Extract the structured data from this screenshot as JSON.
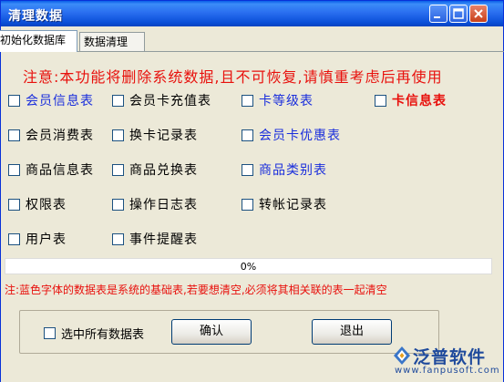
{
  "window": {
    "title": "清理数据"
  },
  "tabs": [
    {
      "label": "初始化数据库",
      "active": true
    },
    {
      "label": "数据清理",
      "active": false
    }
  ],
  "warning": "注意:本功能将删除系统数据,且不可恢复,请慎重考虑后再使用",
  "tables": [
    {
      "label": "会员信息表",
      "color": "blue",
      "checked": false
    },
    {
      "label": "会员卡充值表",
      "color": "black",
      "checked": false
    },
    {
      "label": "卡等级表",
      "color": "blue",
      "checked": false
    },
    {
      "label": "卡信息表",
      "color": "red",
      "checked": false
    },
    {
      "label": "会员消费表",
      "color": "black",
      "checked": false
    },
    {
      "label": "换卡记录表",
      "color": "black",
      "checked": false
    },
    {
      "label": "会员卡优惠表",
      "color": "blue",
      "checked": false
    },
    {
      "label": "商品信息表",
      "color": "black",
      "checked": false
    },
    {
      "label": "商品兑换表",
      "color": "black",
      "checked": false
    },
    {
      "label": "商品类别表",
      "color": "blue",
      "checked": false
    },
    {
      "label": "权限表",
      "color": "black",
      "checked": false
    },
    {
      "label": "操作日志表",
      "color": "black",
      "checked": false
    },
    {
      "label": "转帐记录表",
      "color": "black",
      "checked": false
    },
    {
      "label": "用户表",
      "color": "black",
      "checked": false
    },
    {
      "label": "事件提醒表",
      "color": "black",
      "checked": false
    }
  ],
  "progress": {
    "label": "0%",
    "value": 0
  },
  "note": "注:蓝色字体的数据表是系统的基础表,若要想清空,必须将其相关联的表一起清空",
  "select_all": {
    "label": "选中所有数据表",
    "checked": false
  },
  "buttons": {
    "confirm": "确认",
    "exit": "退出"
  },
  "watermark": {
    "brand": "泛普软件",
    "url": "www.fanpusoft.com"
  },
  "colors": {
    "blue_text": "#1a2edc",
    "red_text": "#e8100c",
    "title_bar": "#0a5fe8"
  }
}
